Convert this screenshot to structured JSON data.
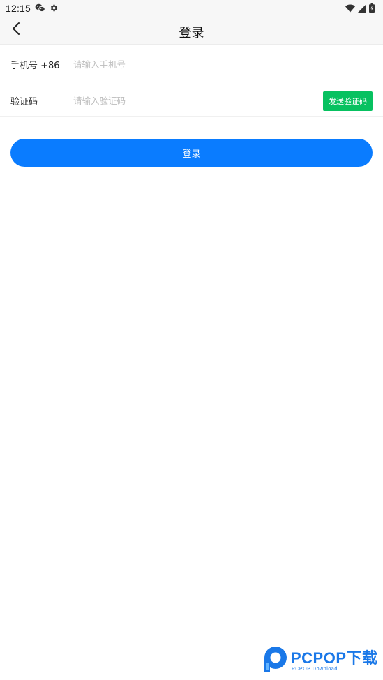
{
  "status_bar": {
    "time": "12:15",
    "left_icons": [
      "wechat-icon",
      "settings-gear-icon"
    ],
    "right_icons": [
      "wifi-icon",
      "signal-icon",
      "battery-icon"
    ]
  },
  "app_bar": {
    "title": "登录",
    "back_icon": "chevron-left-icon"
  },
  "form": {
    "phone": {
      "label": "手机号 +86",
      "value": "",
      "placeholder": "请输入手机号"
    },
    "code": {
      "label": "验证码",
      "value": "",
      "placeholder": "请输入验证码",
      "send_label": "发送验证码"
    },
    "login_label": "登录"
  },
  "watermark": {
    "brand": "PCPOP下载",
    "sub": "PCPOP Download"
  },
  "colors": {
    "primary_blue": "#0a7cff",
    "send_green": "#07c160",
    "bar_background": "#f7f7f7",
    "placeholder": "#bdbdbd"
  }
}
